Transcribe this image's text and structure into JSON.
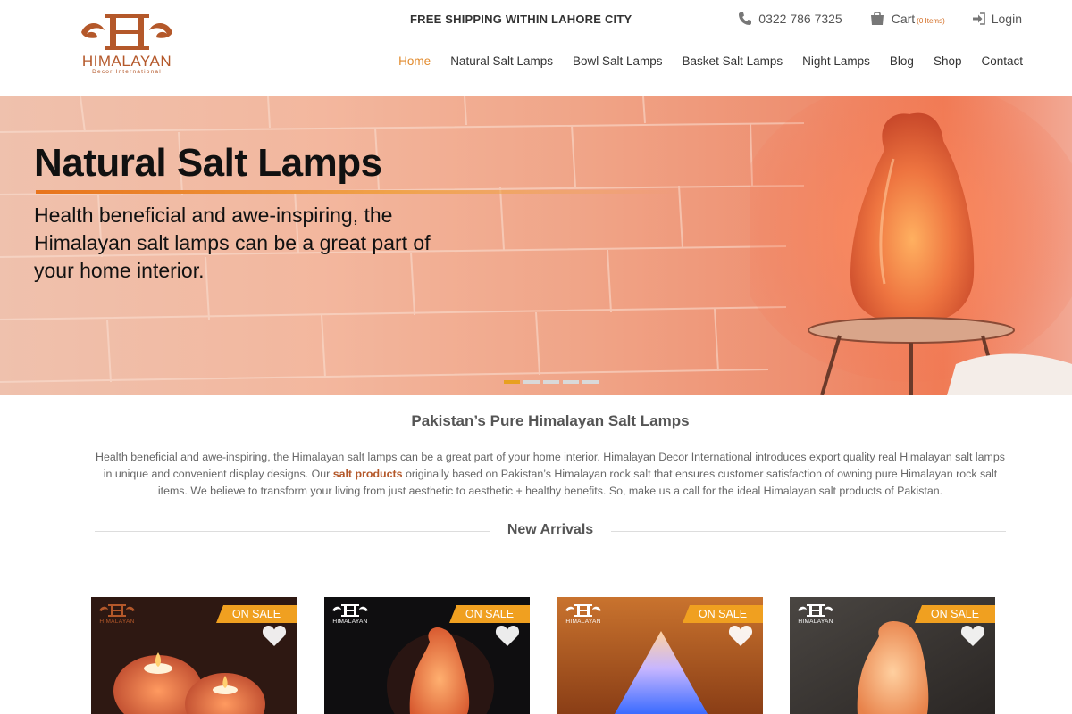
{
  "header": {
    "logo": {
      "name": "HIMALAYAN",
      "tagline": "Decor International"
    },
    "free_shipping": "FREE SHIPPING WITHIN LAHORE CITY",
    "phone": "0322 786 7325",
    "cart_label": "Cart",
    "cart_count": "(0 Items)",
    "login_label": "Login",
    "nav": [
      {
        "label": "Home",
        "active": true
      },
      {
        "label": "Natural Salt Lamps"
      },
      {
        "label": "Bowl Salt Lamps"
      },
      {
        "label": "Basket Salt Lamps"
      },
      {
        "label": "Night Lamps"
      },
      {
        "label": "Blog"
      },
      {
        "label": "Shop"
      },
      {
        "label": "Contact"
      }
    ]
  },
  "hero": {
    "title": "Natural Salt Lamps",
    "text": "Health beneficial and awe-inspiring, the Himalayan salt lamps can be a great part of your home interior.",
    "slides": 5,
    "active_slide": 1
  },
  "intro": {
    "title": "Pakistan’s Pure Himalayan Salt Lamps",
    "text_before": "Health beneficial and awe-inspiring, the Himalayan salt lamps can be a great part of your home interior. Himalayan Decor International introduces export quality real Himalayan salt lamps in unique and convenient display designs. Our ",
    "highlight": "salt products",
    "text_after": " originally based on Pakistan’s Himalayan rock salt that ensures customer satisfaction of owning pure Himalayan rock salt items. We believe to transform your living from just aesthetic to aesthetic + healthy benefits. So, make us a call for the ideal Himalayan salt products of Pakistan."
  },
  "new_arrivals": {
    "title": "New Arrivals",
    "products": [
      {
        "badge": "ON SALE",
        "brand": "HIMALAYAN"
      },
      {
        "badge": "ON SALE",
        "brand": "HIMALAYAN"
      },
      {
        "badge": "ON SALE",
        "brand": "HIMALAYAN"
      },
      {
        "badge": "ON SALE",
        "brand": "HIMALAYAN"
      }
    ]
  },
  "colors": {
    "accent": "#e28a2c",
    "brand": "#b4582a",
    "sale_badge": "#f0a020",
    "slider_active": "#e8a020"
  },
  "icons": [
    "phone-icon",
    "cart-icon",
    "login-icon",
    "heart-icon"
  ]
}
